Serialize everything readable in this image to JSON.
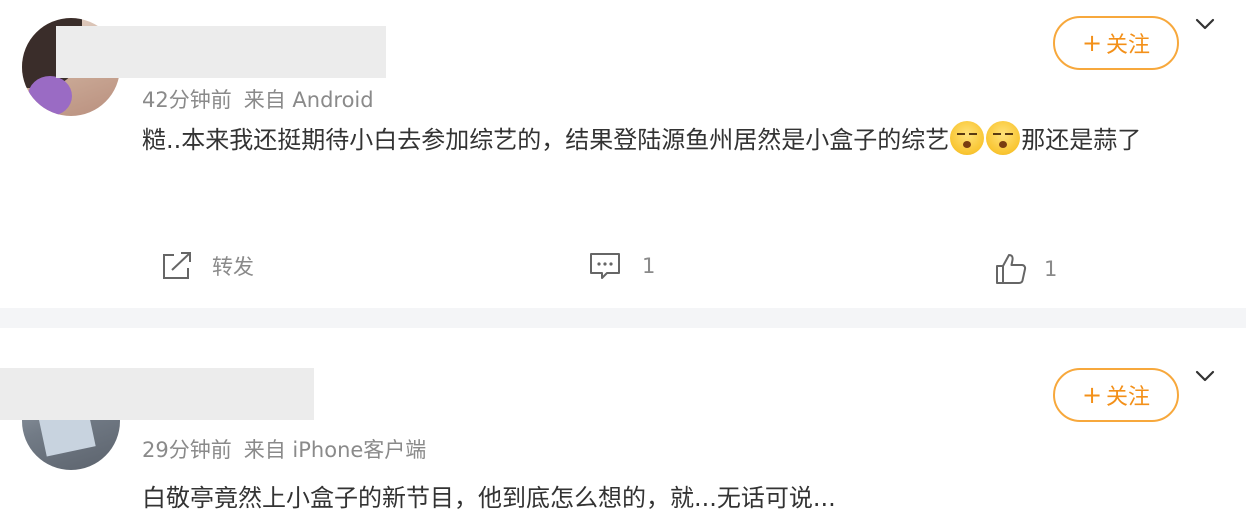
{
  "posts": [
    {
      "meta_time": "42分钟前",
      "meta_source": "来自 Android",
      "content_part1": "糙..本来我还挺期待小白去参加综艺的，结果登陆源鱼州居然是小盒子的综艺",
      "content_part2": "那还是蒜了",
      "follow_label": "关注",
      "repost_label": "转发",
      "comment_count": "1",
      "like_count": "1"
    },
    {
      "meta_time": "29分钟前",
      "meta_source": "来自 iPhone客户端",
      "content": "白敬亭竟然上小盒子的新节目，他到底怎么想的，就...无话可说...",
      "follow_label": "关注"
    }
  ],
  "icons": {
    "follow_plus": "plus-icon",
    "menu": "chevron-down-icon",
    "repost": "repost-icon",
    "comment": "comment-icon",
    "like": "thumbs-up-icon",
    "emoji": "speechless-face-emoji"
  },
  "colors": {
    "accent": "#f39019",
    "accent_border": "#f7a83c",
    "meta_text": "#8a8a8a",
    "body_text": "#333333",
    "divider": "#f4f5f7"
  }
}
